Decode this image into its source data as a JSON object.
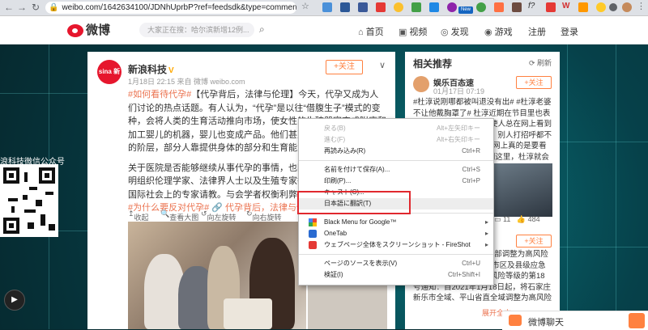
{
  "browser": {
    "url": "weibo.com/1642634100/JDNhUprbP?ref=feedsdk&type=comment#_r...",
    "ext_labels": {
      "new_badge": "New",
      "f9": "f?",
      "w": "W"
    }
  },
  "weibo_nav": {
    "logo": "微博",
    "search_placeholder": "大家正在搜：哈尔滨新增12例...",
    "items": [
      "首页",
      "视频",
      "发现",
      "游戏",
      "注册",
      "登录"
    ]
  },
  "left_widget": {
    "title": "浪科技微信公众号"
  },
  "post": {
    "avatar_text": "sina 新浪科技",
    "author": "新浪科技",
    "verified": "V",
    "meta": "1月18日 22:15 来自 微博 weibo.com",
    "follow": "+关注",
    "paragraph1_tag": "#如何看待代孕#",
    "paragraph1": "【代孕背后，法律与伦理】今天，代孕又成为人们讨论的热点话题。有人认为，“代孕”是以往“借腹生子”模式的变种，会将人类的生育活动推向市场，使女性的生殖器官变成附庸和加工婴儿的机器，婴儿也变成产品。他们甚至拒心这会形成一个新的阶层，部分人靠提供身体的部分和生育能力为生。",
    "paragraph2": "关于医院是否能够继续从事代孕的事情，也因抗着政府相关政府管明组织伦理学家、法律界人士以及生殖专家等参与讨论，甚至还向国际社会上的专家请教。与会学者权衡利弊，",
    "tags_line": "#为什么要反对代孕#  🔗 代孕背后，法律与伦理",
    "actions": [
      "收起",
      "查看大图",
      "向左旋转",
      "向右旋转"
    ]
  },
  "right_panel": {
    "title": "相关推荐",
    "refresh": "刷新",
    "item1": {
      "name": "娱乐百态速",
      "time": "01月17日 07:19",
      "follow": "+关注",
      "text": "#杜淳说刚哪都被叫退没有出# #杜淳老婆不让他戴胸罩了# 杜淳近期在节目里也表示，自己自从嘴了整体使人总在网上看到有人黑他，说他看不惯，别人打招呼都不行：“现在就是这样，在网上真的是要看啊”至“这边看好杜淳说到这里，杜淳就会一些事再去就舞了也是好好好看的..."
    },
    "stats": {
      "comments": "11",
      "likes": "484"
    },
    "item2": {
      "follow": "+关注",
      "text": "#河北省会石家庄市已全部调整为高风险地区# #河北# 石家庄市市区及县级应急防控响应机制关于调整风险等级的第18号通知：自2021年1月18日起，将石家庄新乐市全域、平山省直全域调整为高风险地区。#河北新乐和南宫全域调为高风险# 目前，石家庄藁城区全域仍为高风险地区，长安区博雅盛世小...",
      "more": "展开全文"
    }
  },
  "context_menu": {
    "items": [
      {
        "label": "戻る(B)",
        "shortcut": "Alt+左矢印キー",
        "disabled": true
      },
      {
        "label": "進む(F)",
        "shortcut": "Alt+右矢印キー",
        "disabled": true
      },
      {
        "label": "再読み込み(R)",
        "shortcut": "Ctrl+R",
        "disabled": false
      },
      {
        "label": "名前を付けて保存(A)...",
        "shortcut": "Ctrl+S",
        "disabled": false
      },
      {
        "label": "印刷(P)...",
        "shortcut": "Ctrl+P",
        "disabled": false
      },
      {
        "label": "キャスト(C)...",
        "shortcut": "",
        "disabled": false
      },
      {
        "label": "日本語に翻訳(T)",
        "shortcut": "",
        "disabled": false
      },
      {
        "label": "Black Menu for Google™",
        "shortcut": "",
        "disabled": false
      },
      {
        "label": "OneTab",
        "shortcut": "",
        "disabled": false
      },
      {
        "label": "ウェブページ全体をスクリーンショット - FireShot",
        "shortcut": "",
        "disabled": false
      },
      {
        "label": "ページのソースを表示(V)",
        "shortcut": "Ctrl+U",
        "disabled": false
      },
      {
        "label": "検証(I)",
        "shortcut": "Ctrl+Shift+I",
        "disabled": false
      }
    ]
  },
  "chat": {
    "label": "微博聊天"
  },
  "colors": {
    "weibo_red": "#e6162d",
    "accent_orange": "#ff8140",
    "highlight_red": "#e0282e"
  }
}
